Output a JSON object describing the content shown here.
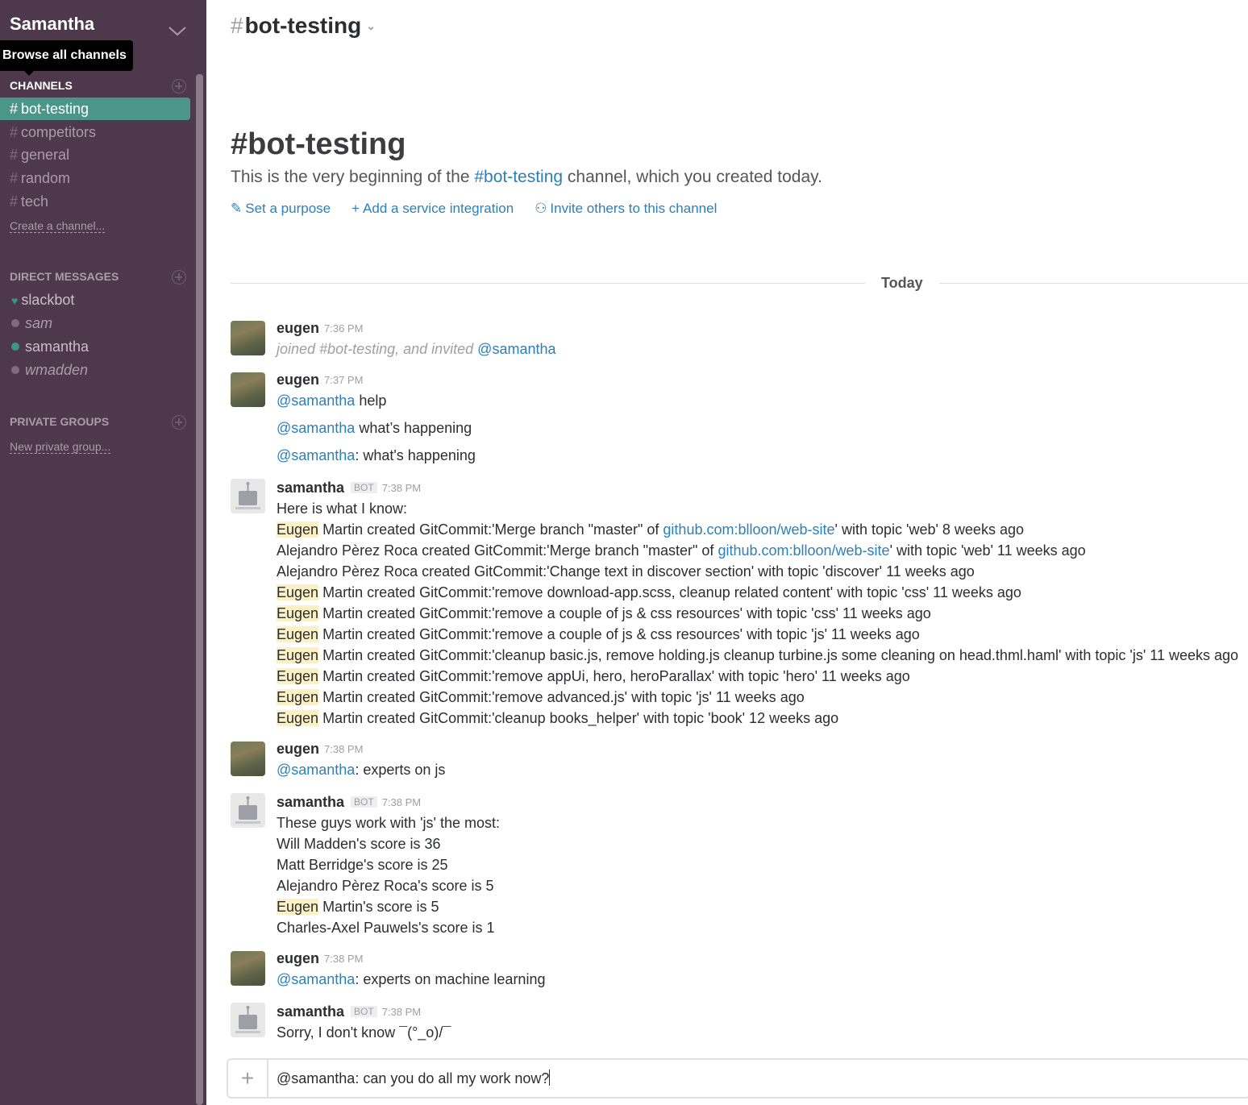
{
  "team": {
    "name": "Samantha"
  },
  "tooltip": "Browse all channels",
  "sidebar": {
    "channels_heading": "CHANNELS",
    "channels": [
      {
        "name": "bot-testing",
        "selected": true
      },
      {
        "name": "competitors"
      },
      {
        "name": "general"
      },
      {
        "name": "random"
      },
      {
        "name": "tech"
      }
    ],
    "create_channel": "Create a channel...",
    "dm_heading": "DIRECT MESSAGES",
    "dms": [
      {
        "name": "slackbot",
        "status": "heart"
      },
      {
        "name": "sam",
        "status": "away"
      },
      {
        "name": "samantha",
        "status": "online"
      },
      {
        "name": "wmadden",
        "status": "away"
      }
    ],
    "groups_heading": "PRIVATE GROUPS",
    "new_group": "New private group..."
  },
  "header": {
    "channel": "bot-testing",
    "hash": "#"
  },
  "intro": {
    "title": "#bot-testing",
    "text_before": "This is the very beginning of the ",
    "text_link": "#bot-testing",
    "text_after": " channel, which you created today.",
    "actions": [
      "Set a purpose",
      "Add a service integration",
      "Invite others to this channel"
    ]
  },
  "divider": "Today",
  "messages": {
    "m1": {
      "author": "eugen",
      "time": "7:36 PM",
      "sys": "joined #bot-testing, and invited ",
      "mention": "@samantha"
    },
    "m2": {
      "author": "eugen",
      "time": "7:37 PM",
      "mention": "@samantha",
      "l1": " help",
      "l2": " what’s happening",
      "l3": ": what's happening"
    },
    "m3": {
      "author": "samantha",
      "badge": "BOT",
      "time": "7:38 PM",
      "intro": "Here is what I know:",
      "hl": "Eugen",
      "c1a": " Martin created GitCommit:'Merge branch \"master\" of ",
      "c1l": "github.com:blloon/web-site",
      "c1b": "' with topic 'web' 8 weeks ago",
      "c2a": "Alejandro Pèrez Roca created GitCommit:'Merge branch \"master\" of ",
      "c2l": "github.com:blloon/web-site",
      "c2b": "' with topic 'web' 11 weeks ago",
      "c3": "Alejandro Pèrez Roca created GitCommit:'Change text in discover section' with topic 'discover' 11 weeks ago",
      "c4": " Martin created GitCommit:'remove download-app.scss, cleanup related content' with topic 'css' 11 weeks ago",
      "c5": " Martin created GitCommit:'remove a couple of js & css resources' with topic 'css' 11 weeks ago",
      "c6": " Martin created GitCommit:'remove a couple of js & css resources' with topic 'js' 11 weeks ago",
      "c7": " Martin created GitCommit:'cleanup basic.js, remove holding.js cleanup turbine.js some cleaning on head.thml.haml' with topic 'js' 11 weeks ago",
      "c8": " Martin created GitCommit:'remove appUi, hero, heroParallax' with topic 'hero' 11 weeks ago",
      "c9": " Martin created GitCommit:'remove advanced.js' with topic 'js' 11 weeks ago",
      "c10": " Martin created GitCommit:'cleanup books_helper' with topic 'book' 12 weeks ago"
    },
    "m4": {
      "author": "eugen",
      "time": "7:38 PM",
      "mention": "@samantha",
      "text": ": experts on js"
    },
    "m5": {
      "author": "samantha",
      "badge": "BOT",
      "time": "7:38 PM",
      "intro": "These guys work with 'js' the most:",
      "s1": "Will Madden's score is 36",
      "s2": "Matt Berridge's score is 25",
      "s3": "Alejandro Pèrez Roca's score is 5",
      "s4hl": "Eugen",
      "s4": " Martin's score is 5",
      "s5": "Charles-Axel Pauwels's score is 1"
    },
    "m6": {
      "author": "eugen",
      "time": "7:38 PM",
      "mention": "@samantha",
      "text": ": experts on machine learning"
    },
    "m7": {
      "author": "samantha",
      "badge": "BOT",
      "time": "7:38 PM",
      "text": "Sorry, I don't know ¯(°_o)/¯"
    }
  },
  "composer": {
    "plus": "+",
    "value": "@samantha: can you do all my work now?"
  },
  "colors": {
    "sidebar": "#4d394b",
    "selected": "#4c9689",
    "link": "#2a80b9",
    "highlight": "#fcf1c4"
  }
}
